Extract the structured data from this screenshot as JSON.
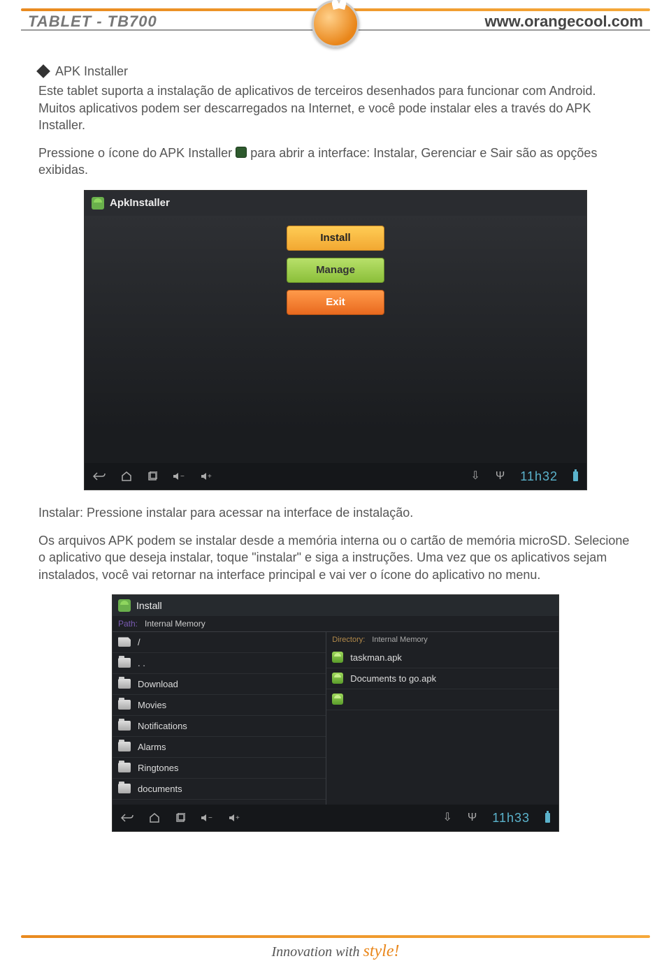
{
  "header": {
    "product": "TABLET - TB700",
    "url": "www.orangecool.com"
  },
  "section": {
    "title": "APK Installer",
    "intro": "Este tablet suporta a instalação de aplicativos de terceiros desenhados para funcionar com Android. Muitos aplicativos podem ser descarregados na Internet, e você pode instalar eles a través do APK Installer.",
    "press_pre": "Pressione o ícone do APK Installer ",
    "press_post": " para abrir a interface: Instalar, Gerenciar e Sair são as opções exibidas."
  },
  "apk_main": {
    "title": "ApkInstaller",
    "install": "Install",
    "manage": "Manage",
    "exit": "Exit",
    "clock": "11h32"
  },
  "mid": {
    "install_desc": "Instalar: Pressione instalar para acessar na interface de instalação.",
    "apk_desc": "Os arquivos APK podem se instalar desde a memória interna ou o cartão de memória microSD. Selecione o aplicativo que deseja instalar, toque \"instalar\" e siga a instruções. Uma vez que os aplicativos sejam instalados, você vai retornar na interface principal e vai ver o ícone do aplicativo no menu."
  },
  "install_screen": {
    "title": "Install",
    "path_label": "Path:",
    "path_value": "Internal Memory",
    "dir_label": "Directory:",
    "dir_value": "Internal Memory",
    "left_items": [
      "/",
      ". .",
      "Download",
      "Movies",
      "Notifications",
      "Alarms",
      "Ringtones",
      "documents"
    ],
    "right_items": [
      "taskman.apk",
      "Documents to go.apk",
      ""
    ],
    "clock": "11h33"
  },
  "footer": {
    "text_pre": "Innovation with ",
    "text_style": "style!"
  }
}
